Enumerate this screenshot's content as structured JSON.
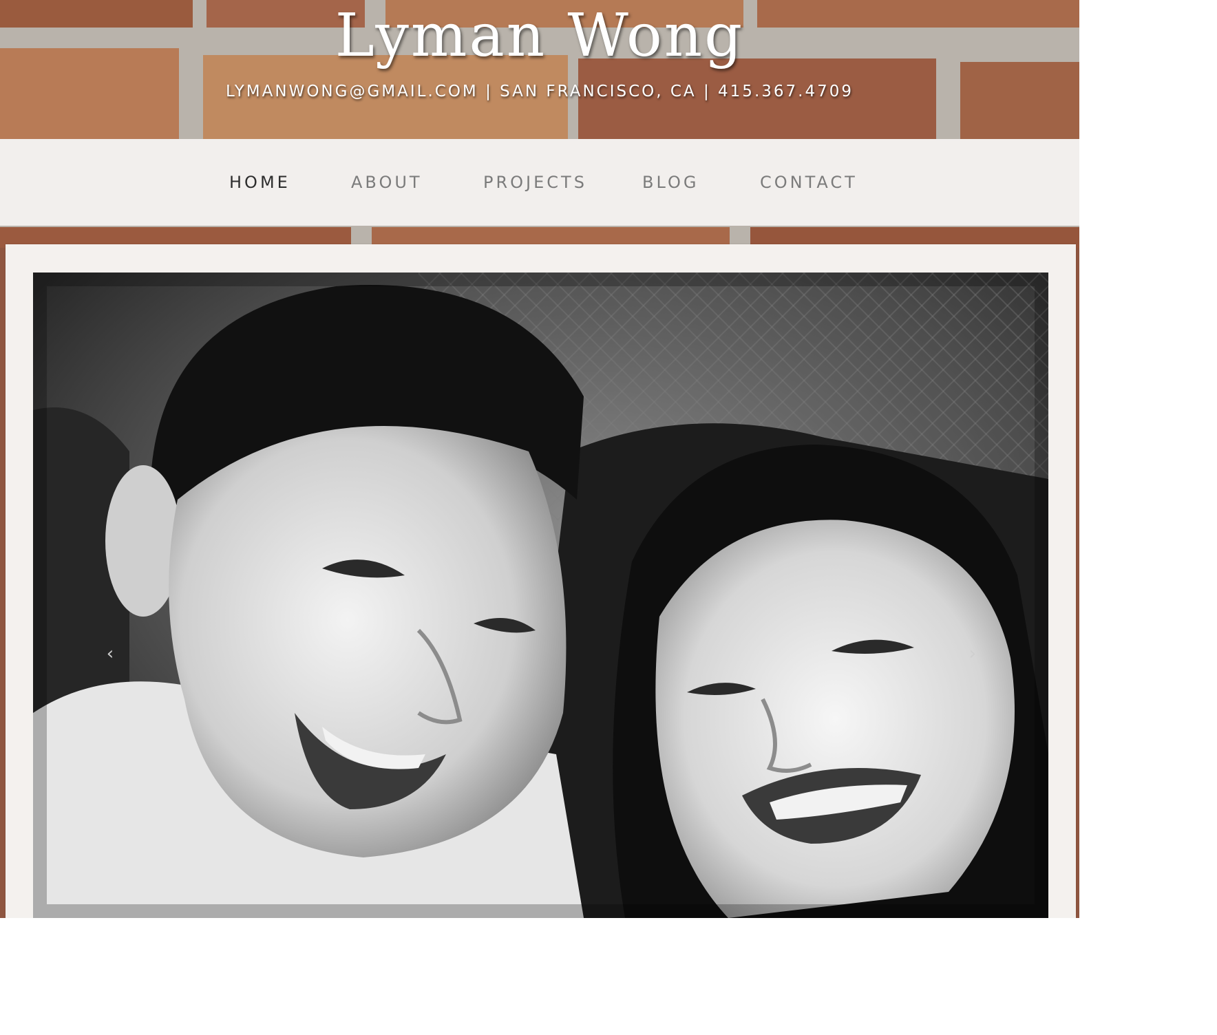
{
  "header": {
    "title": "Lyman Wong",
    "contact_line": "LYMANWONG@GMAIL.COM | SAN FRANCISCO, CA | 415.367.4709"
  },
  "nav": {
    "items": [
      {
        "label": "HOME",
        "active": true
      },
      {
        "label": "ABOUT",
        "active": false
      },
      {
        "label": "PROJECTS",
        "active": false
      },
      {
        "label": "BLOG",
        "active": false
      },
      {
        "label": "CONTACT",
        "active": false
      }
    ]
  },
  "carousel": {
    "prev_icon": "chevron-left-icon",
    "next_icon": "chevron-right-icon",
    "prev_glyph": "‹",
    "next_glyph": "›"
  },
  "colors": {
    "brick": "#9c5a3c",
    "mortar": "#b9b3ab",
    "nav_bg": "#f2efed",
    "nav_text": "#7b7b7b",
    "nav_active": "#2d2d2d"
  }
}
